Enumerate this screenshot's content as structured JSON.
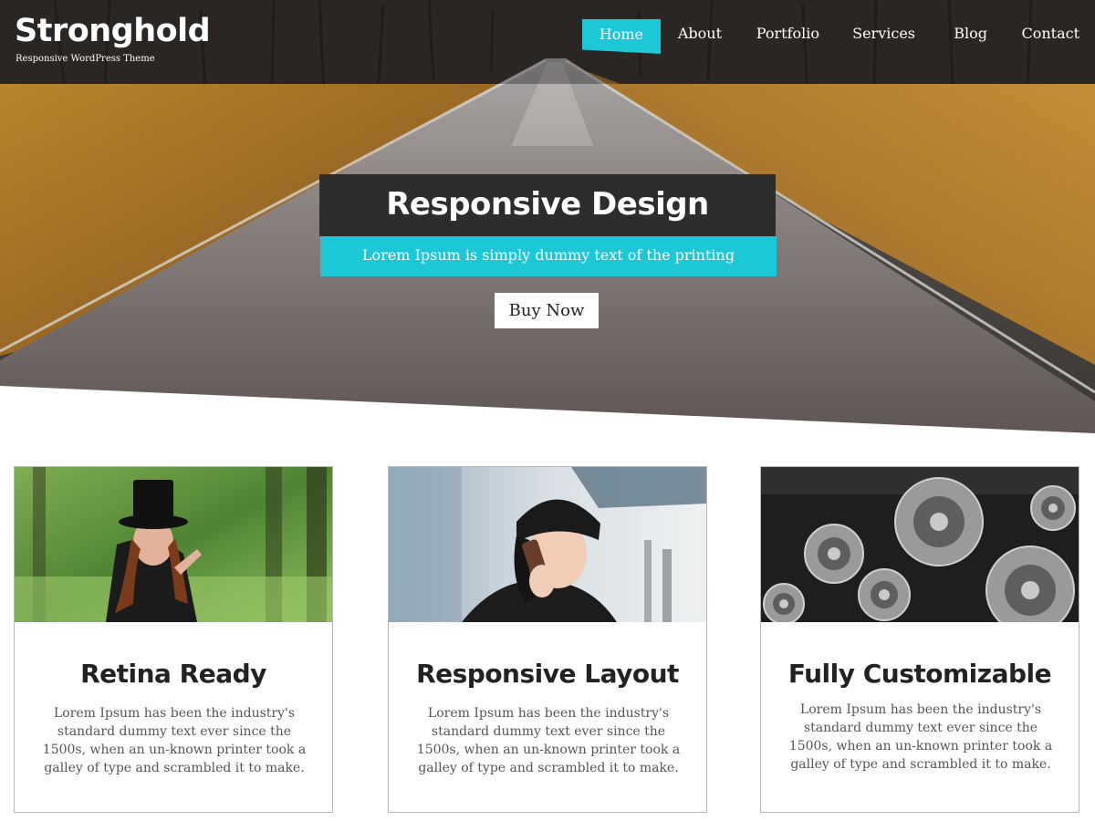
{
  "site": {
    "title": "Stronghold",
    "tagline": "Responsive WordPress Theme"
  },
  "nav": {
    "items": [
      {
        "label": "Home",
        "active": true
      },
      {
        "label": "About",
        "active": false
      },
      {
        "label": "Portfolio",
        "active": false
      },
      {
        "label": "Services",
        "active": false
      },
      {
        "label": "Blog",
        "active": false
      },
      {
        "label": "Contact",
        "active": false
      }
    ]
  },
  "slider": {
    "title": "Responsive Design",
    "subtitle": "Lorem Ipsum is simply dummy text of the printing",
    "button": "Buy Now"
  },
  "features": [
    {
      "title": "Retina Ready",
      "text": "Lorem Ipsum has been the industry's standard dummy text ever since the 1500s, when an un-known printer took a galley of type and scrambled it to make."
    },
    {
      "title": "Responsive Layout",
      "text": "Lorem Ipsum has been the industry's standard dummy text ever since the 1500s, when an un-known printer took a galley of type and scrambled it to make."
    },
    {
      "title": "Fully Customizable",
      "text": "Lorem Ipsum has been the industry's standard dummy text ever since the 1500s, when an un-known printer took a galley of type and scrambled it to make."
    }
  ],
  "colors": {
    "accent": "#1cc7d6",
    "dark": "#2d2d2d"
  }
}
